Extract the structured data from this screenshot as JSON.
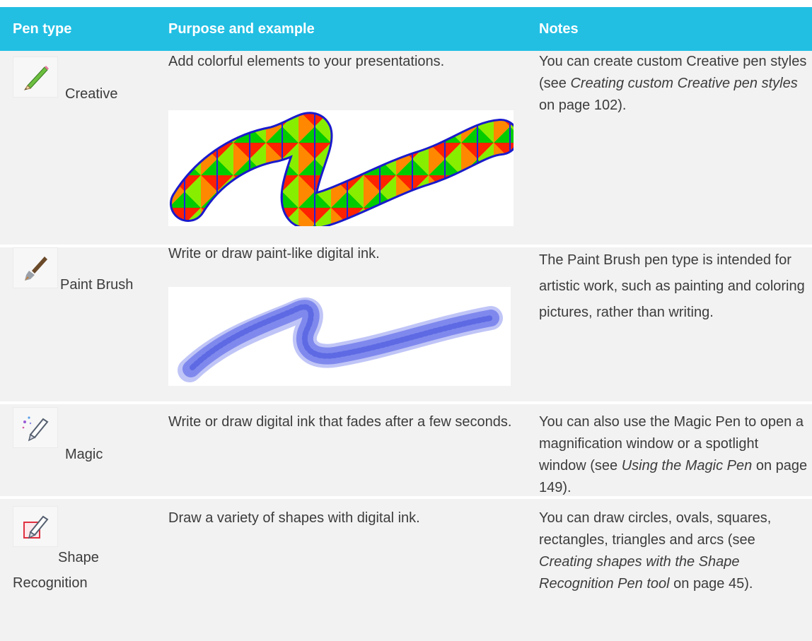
{
  "table": {
    "headers": {
      "pen_type": "Pen type",
      "purpose": "Purpose and example",
      "notes": "Notes"
    },
    "rows": [
      {
        "pen": "Creative",
        "icon": "pencil-icon",
        "purpose": "Add colorful elements to your presentations.",
        "example_image": "creative-pen-stroke",
        "notes_pre": "You can create custom Creative pen styles (see ",
        "notes_link": "Creating custom Creative pen styles",
        "notes_post": " on page 102)."
      },
      {
        "pen": "Paint Brush",
        "icon": "paint-brush-icon",
        "purpose": "Write or draw paint-like digital ink.",
        "example_image": "paint-brush-stroke",
        "notes": "The Paint Brush pen type is intended for artistic work, such as painting and coloring pictures, rather than writing."
      },
      {
        "pen": "Magic",
        "icon": "magic-pen-icon",
        "purpose": "Write or draw digital ink that fades after a few seconds.",
        "notes_pre": "You can also use the Magic Pen to open a magnification window or a spotlight window (see ",
        "notes_link": "Using the Magic Pen",
        "notes_post": " on page 149)."
      },
      {
        "pen": "Shape Recognition",
        "pen_line1": "Shape",
        "pen_line2": "Recognition",
        "icon": "shape-recognition-icon",
        "purpose": "Draw a variety of shapes with digital ink.",
        "notes_pre": "You can draw circles, ovals, squares, rectangles, triangles and arcs (see ",
        "notes_link": "Creating shapes with the Shape Recognition Pen tool",
        "notes_post": " on page 45)."
      }
    ]
  },
  "colors": {
    "header_bg": "#22bfe3",
    "row_bg": "#f2f2f2",
    "creative_outline": "#1a1acc",
    "paint_brush_ink": "#4a5ae8"
  }
}
